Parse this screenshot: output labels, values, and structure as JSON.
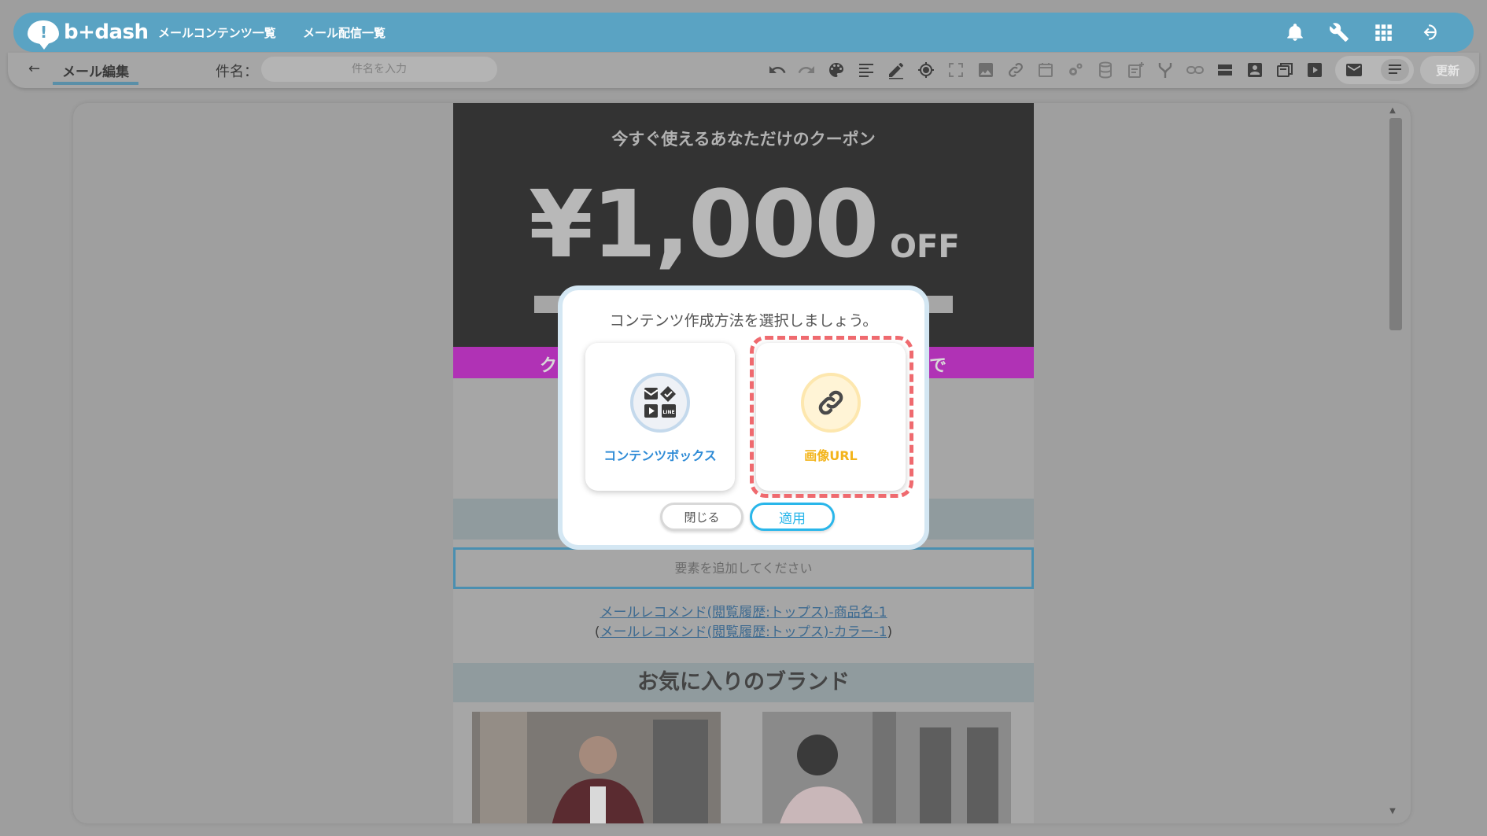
{
  "app": {
    "logo_text": "b+dash",
    "nav": [
      {
        "label": "メールコンテンツ一覧"
      },
      {
        "label": "メール配信一覧"
      }
    ]
  },
  "toolbar": {
    "back_label": "←",
    "page_title": "メール編集",
    "subject_label": "件名：",
    "subject_placeholder": "件名を入力",
    "update_label": "更新"
  },
  "email": {
    "coupon_title": "今すぐ使えるあなただけのクーポン",
    "coupon_amount": "¥1,000",
    "coupon_off": "OFF",
    "banner_left": "ク",
    "banner_right": "で",
    "add_element_text": "要素を追加してください",
    "rec_product_name": "メールレコメンド(閲覧履歴:トップス)-商品名-1",
    "rec_color_open": "(",
    "rec_color": "メールレコメンド(閲覧履歴:トップス)-カラー-1",
    "rec_color_close": ")",
    "brand_header": "お気に入りのブランド"
  },
  "modal": {
    "title": "コンテンツ作成方法を選択しましょう。",
    "option_contents_box": "コンテンツボックス",
    "option_image_url": "画像URL",
    "close_label": "閉じる",
    "apply_label": "適用"
  },
  "colors": {
    "topbar": "#5aa3c3",
    "highlight_dash": "#ef6a6f",
    "apply_accent": "#29b6ea",
    "contents_box_label": "#2e8bd6",
    "image_url_label": "#f3b41b"
  }
}
